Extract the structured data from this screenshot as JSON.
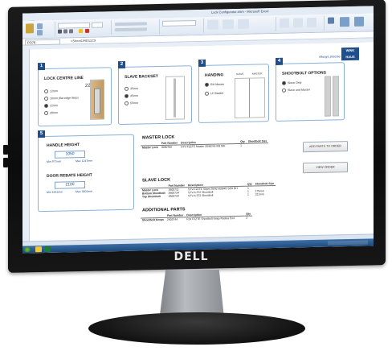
{
  "device": {
    "brand_logo": "DELL"
  },
  "excel": {
    "title": "Lock Configurator.xlsm - Microsoft Excel",
    "tabs": [
      "File",
      "Home",
      "Insert",
      "Page Layout",
      "Formulas",
      "Data",
      "Review",
      "View",
      "Developer",
      "Add-Ins"
    ],
    "name_box": "PO76",
    "formula": "=Sheet1!RD11C9"
  },
  "form": {
    "brand_tagline": "Always precise",
    "brand_logo": "WINK HAUS",
    "sections": [
      {
        "num": "1",
        "title": "LOCK CENTRE LINE",
        "value_label": "22",
        "options": [
          {
            "label": "12mm",
            "selected": false
          },
          {
            "label": "16mm (flat edge Strip)",
            "selected": false
          },
          {
            "label": "22mm",
            "selected": true
          },
          {
            "label": "28mm",
            "selected": false
          }
        ]
      },
      {
        "num": "2",
        "title": "SLAVE BACKSET",
        "options": [
          {
            "label": "35mm",
            "selected": false
          },
          {
            "label": "45mm",
            "selected": true
          },
          {
            "label": "55mm",
            "selected": false
          }
        ]
      },
      {
        "num": "3",
        "title": "HANDING",
        "col_a": "SLAVE",
        "col_b": "MASTER",
        "options": [
          {
            "label": "RH Master",
            "selected": true
          },
          {
            "label": "LH Master",
            "selected": false
          }
        ]
      },
      {
        "num": "4",
        "title": "SHOOTBOLT OPTIONS",
        "options": [
          {
            "label": "Slave Only",
            "selected": true
          },
          {
            "label": "Slave and Master",
            "selected": false
          }
        ]
      },
      {
        "num": "5",
        "title": "HANDLE HEIGHT",
        "handle_value": "1050",
        "handle_min": "Min 977mm",
        "handle_max": "Max 1247mm",
        "rebate_title": "DOOR REBATE HEIGHT",
        "rebate_value": "2100",
        "rebate_min": "Min 1661mm",
        "rebate_max": "Max 3001mm"
      }
    ],
    "master_lock": {
      "title": "MASTER LOCK",
      "headers": [
        "",
        "Part Number",
        "Description",
        "Qty",
        "Shootbolt Size"
      ],
      "rows": [
        [
          "Master Lock",
          "3060705",
          "STV-F2ZTE Master 20/82/45 M3 MH",
          "1",
          ""
        ]
      ]
    },
    "slave_lock": {
      "title": "SLAVE LOCK",
      "headers": [
        "",
        "Part Number",
        "Description",
        "Qty",
        "Shootbolt Size"
      ],
      "rows": [
        [
          "Master Lock",
          "2600711",
          "STV-F2ZTE Slave 20/92 B30/45 SD9 RH",
          "1",
          ""
        ],
        [
          "Bottom Shootbolt",
          "2600734",
          "STV-A 372 Shootbolt",
          "1",
          "175mm"
        ],
        [
          "Top Shootbolt",
          "2600734",
          "STV-A 372 Shootbolt",
          "1",
          "311mm"
        ]
      ]
    },
    "additional": {
      "title": "ADDITIONAL PARTS",
      "headers": [
        "",
        "Part Number",
        "Description",
        "Qty"
      ],
      "rows": [
        [
          "Shootbolt Keeps",
          "2603744",
          "F24 F2ZTE Shootbolt Keep Radius End",
          "2"
        ]
      ]
    },
    "buttons": {
      "add": "ADD PARTS TO ORDER",
      "view": "VIEW ORDER"
    }
  },
  "colors": {
    "accent": "#1f4e8c",
    "border": "#8ab1d9"
  }
}
